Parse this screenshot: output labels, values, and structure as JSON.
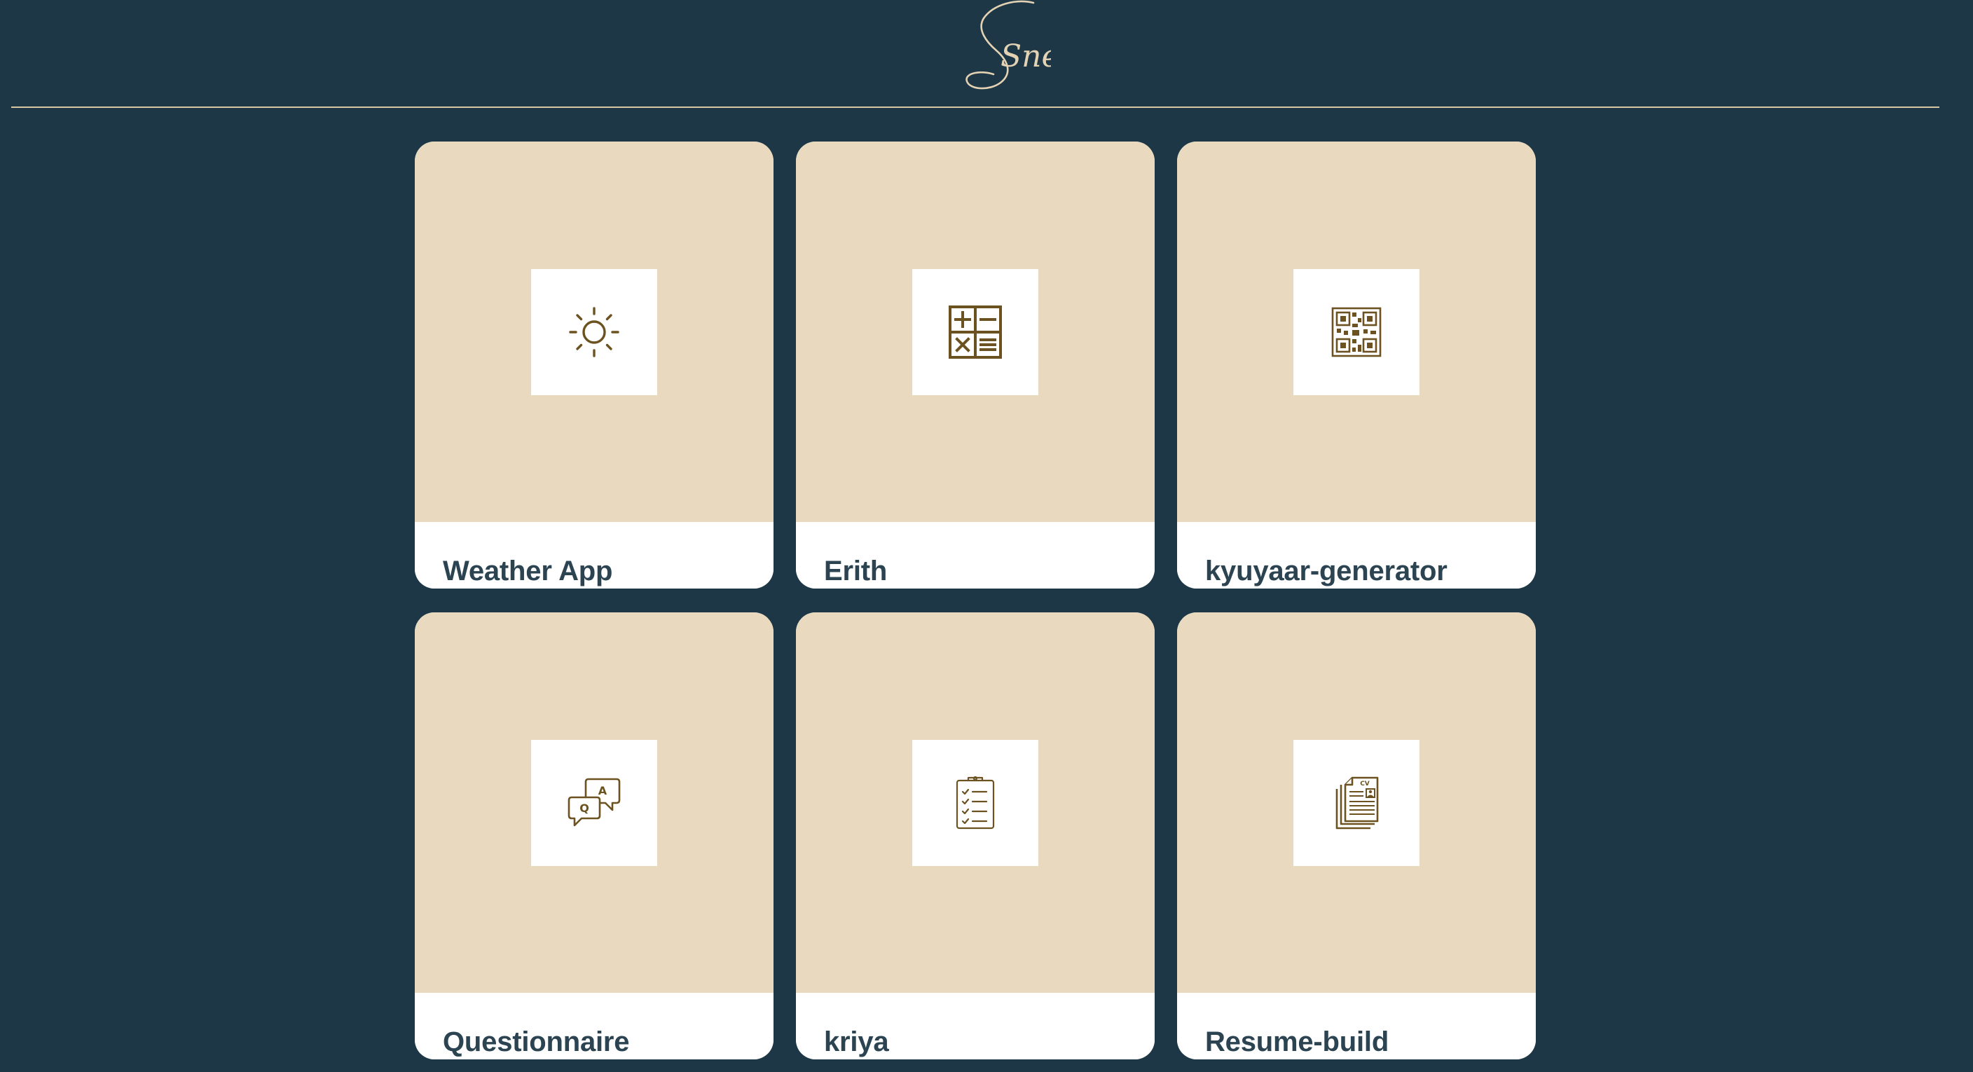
{
  "header": {
    "logo_text": "Sneha"
  },
  "projects": [
    {
      "label": "Weather App",
      "icon": "sun-icon"
    },
    {
      "label": "Erith",
      "icon": "calculator-icon"
    },
    {
      "label": "kyuyaar-generator",
      "icon": "qr-code-icon"
    },
    {
      "label": "Questionnaire",
      "icon": "qa-chat-icon"
    },
    {
      "label": "kriya",
      "icon": "clipboard-checklist-icon"
    },
    {
      "label": "Resume-build",
      "icon": "cv-document-icon"
    }
  ],
  "colors": {
    "background": "#1e3746",
    "card_media": "#e8d9bf",
    "icon_stroke": "#6b5220",
    "label_text": "#2c4452",
    "logo": "#e3d2b3"
  }
}
